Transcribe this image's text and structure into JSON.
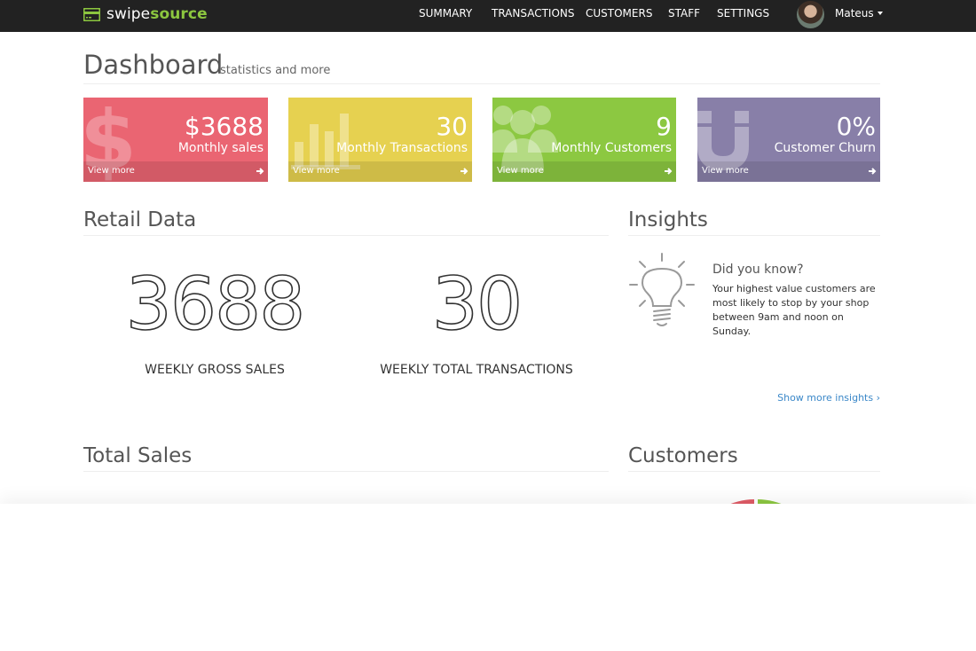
{
  "brand": {
    "name_part1": "swipe",
    "name_part2": "source",
    "accent_color": "#8cc63f"
  },
  "nav": {
    "links": [
      "SUMMARY",
      "TRANSACTIONS",
      "CUSTOMERS",
      "STAFF",
      "SETTINGS"
    ],
    "user_name": "Mateus"
  },
  "header": {
    "title": "Dashboard",
    "subtitle": "statistics and more"
  },
  "tiles": [
    {
      "value": "$3688",
      "label": "Monthly sales",
      "more": "View more",
      "color": "#ea6572",
      "icon": "dollar-icon"
    },
    {
      "value": "30",
      "label": "Monthly Transactions",
      "more": "View more",
      "color": "#e6d150",
      "icon": "bar-chart-icon"
    },
    {
      "value": "9",
      "label": "Monthly Customers",
      "more": "View more",
      "color": "#8cc841",
      "icon": "users-icon"
    },
    {
      "value": "0%",
      "label": "Customer Churn",
      "more": "View more",
      "color": "#887fa8",
      "icon": "magnet-icon"
    }
  ],
  "retail": {
    "title": "Retail Data",
    "stats": [
      {
        "value": "3688",
        "caption": "WEEKLY GROSS SALES"
      },
      {
        "value": "30",
        "caption": "WEEKLY TOTAL TRANSACTIONS"
      }
    ]
  },
  "insights": {
    "title": "Insights",
    "heading": "Did you know?",
    "text": "Your highest value customers are most likely to stop by your shop between 9am and noon on Sunday.",
    "more_link": "Show more insights ›",
    "link_color": "#3a87c8",
    "icon": "lightbulb-icon"
  },
  "sections": {
    "total_sales": "Total Sales",
    "customers": "Customers"
  }
}
